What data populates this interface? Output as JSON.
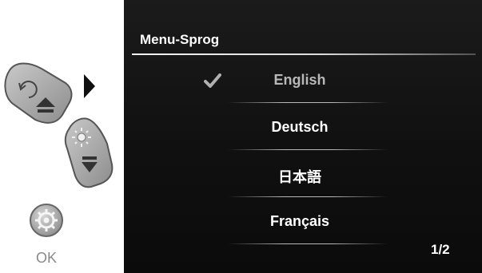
{
  "controls": {
    "ok_label": "OK"
  },
  "menu": {
    "title": "Menu-Sprog",
    "languages": [
      {
        "label": "English",
        "selected": true
      },
      {
        "label": "Deutsch",
        "selected": false
      },
      {
        "label": "日本語",
        "selected": false
      },
      {
        "label": "Français",
        "selected": false
      }
    ],
    "page_indicator": "1/2"
  },
  "colors": {
    "screen_bg": "#121212",
    "text": "#ffffff",
    "selected_text": "#b8b8b8"
  }
}
